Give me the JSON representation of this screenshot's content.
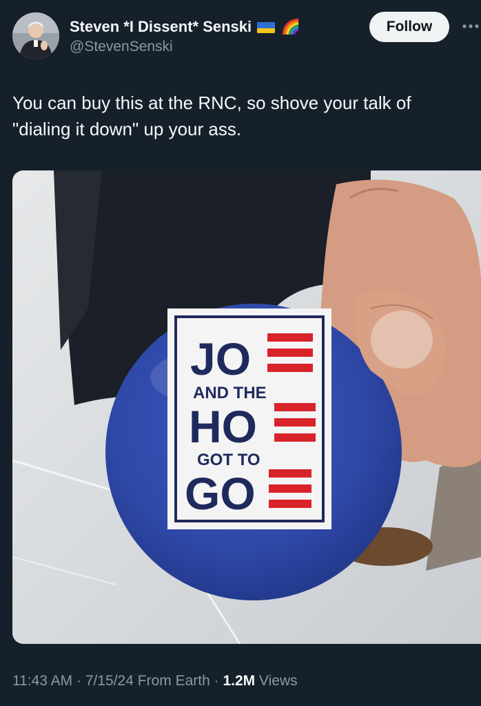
{
  "author": {
    "display_name": "Steven *I Dissent* Senski",
    "handle": "@StevenSenski",
    "badges": [
      "ukraine-flag-icon",
      "rainbow-icon"
    ]
  },
  "follow_label": "Follow",
  "tweet_text": "You can buy this at the RNC, so shove your talk of \"dialing it down\" up your ass.",
  "media": {
    "button_lines": [
      "JO",
      "AND THE",
      "HO",
      "GOT TO",
      "GO"
    ],
    "colors": {
      "button_blue": "#2f49a8",
      "card_white": "#f4f4f4",
      "text_navy": "#1f2a5c",
      "stripe_red": "#d8232a"
    }
  },
  "meta": {
    "time": "11:43 AM",
    "date": "7/15/24",
    "source": "From Earth",
    "views_count": "1.2M",
    "views_label": "Views"
  },
  "colors": {
    "background": "#15202b",
    "text_primary": "#f7f9f9",
    "text_secondary": "#8b98a5",
    "follow_bg": "#eff3f4"
  }
}
